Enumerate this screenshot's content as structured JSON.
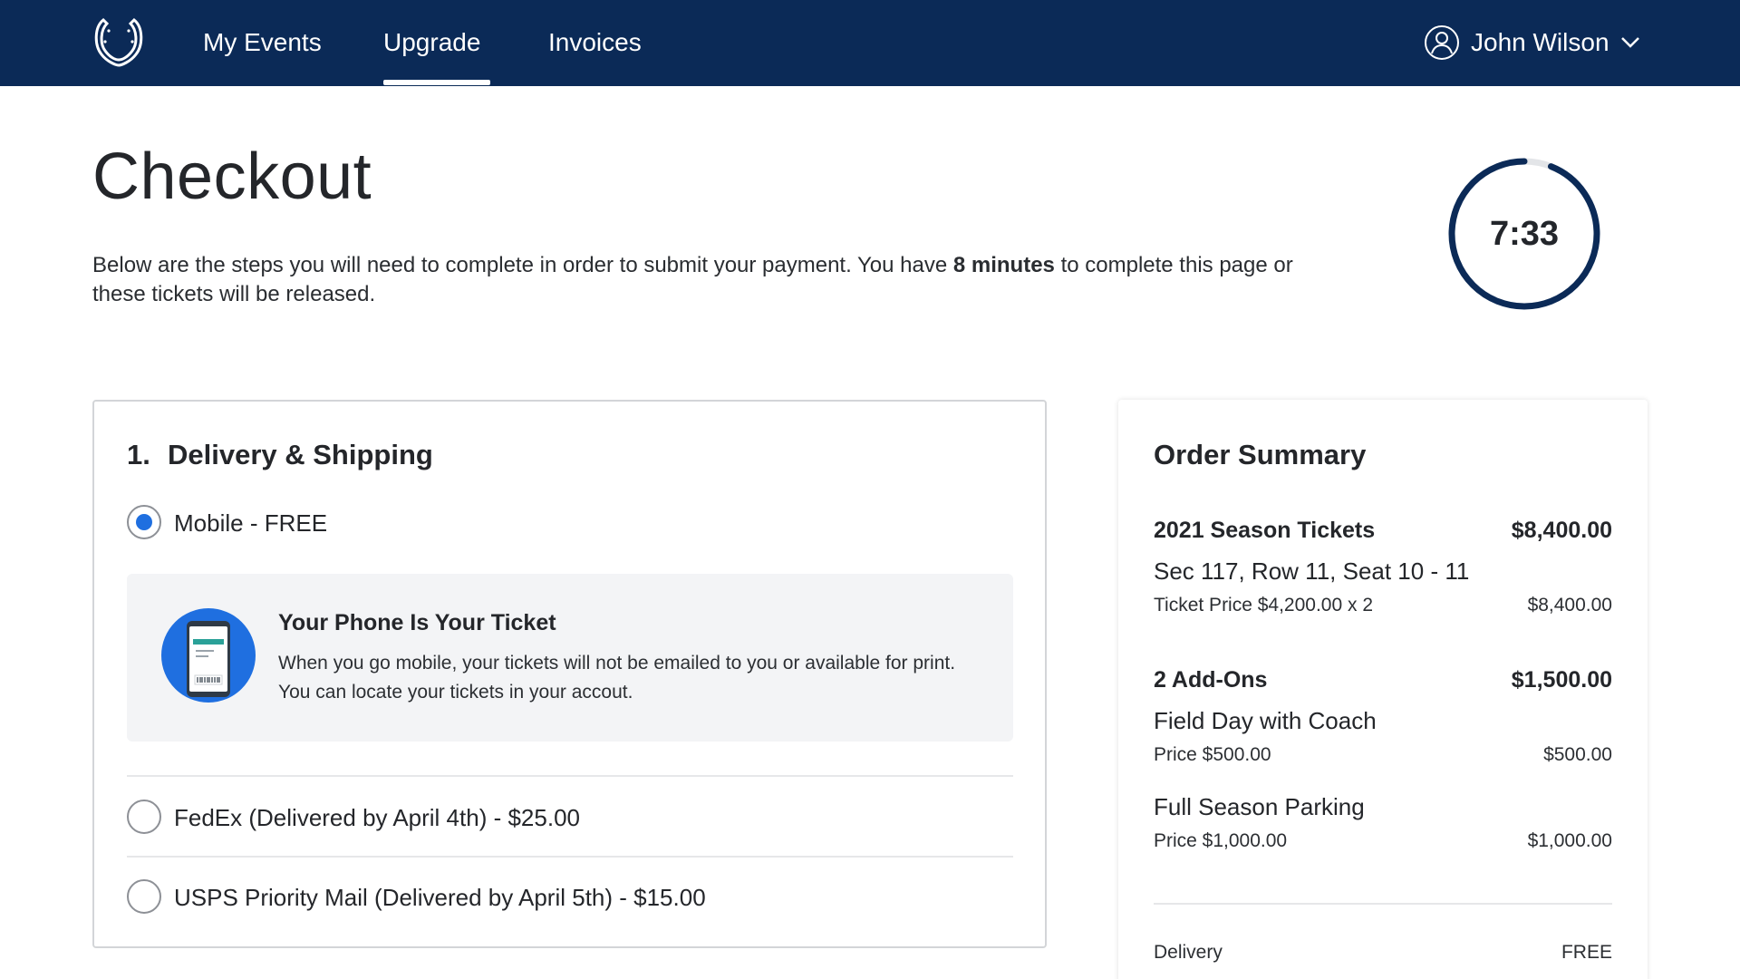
{
  "nav": {
    "links": [
      {
        "label": "My Events"
      },
      {
        "label": "Upgrade"
      },
      {
        "label": "Invoices"
      }
    ],
    "active_link": "Upgrade",
    "user_name": "John Wilson",
    "colors": {
      "bar": "#0b2a57",
      "text": "#ffffff"
    }
  },
  "header": {
    "title": "Checkout",
    "intro_before": "Below are the steps you will need to complete in order to submit your payment. You have ",
    "intro_bold": "8 minutes",
    "intro_after": " to complete this page or these tickets will be released."
  },
  "timer": {
    "display": "7:33",
    "remaining_fraction": 0.94
  },
  "delivery": {
    "step_number": "1.",
    "step_title": "Delivery & Shipping",
    "options": [
      {
        "label": "Mobile - FREE",
        "selected": true
      },
      {
        "label": "FedEx (Delivered by April 4th) - $25.00",
        "selected": false
      },
      {
        "label": "USPS Priority Mail (Delivered by April 5th) - $15.00",
        "selected": false
      }
    ],
    "info": {
      "title": "Your Phone Is Your Ticket",
      "text": "When you go mobile, your tickets will not be emailed to you or available for print. You can locate your tickets in your accout.",
      "icon": "mobile-ticket-icon"
    },
    "accent_color": "#1f6fe0"
  },
  "summary": {
    "title": "Order Summary",
    "tickets": {
      "name": "2021 Season Tickets",
      "total": "$8,400.00",
      "seat": "Sec 117, Row 11, Seat 10 - 11",
      "price_line": "Ticket Price $4,200.00 x 2",
      "price_total": "$8,400.00"
    },
    "addons": {
      "name": "2 Add-Ons",
      "total": "$1,500.00",
      "items": [
        {
          "name": "Field Day with Coach",
          "price_line": "Price $500.00",
          "price_total": "$500.00"
        },
        {
          "name": "Full Season Parking",
          "price_line": "Price $1,000.00",
          "price_total": "$1,000.00"
        }
      ]
    },
    "delivery_label": "Delivery",
    "delivery_value": "FREE"
  }
}
